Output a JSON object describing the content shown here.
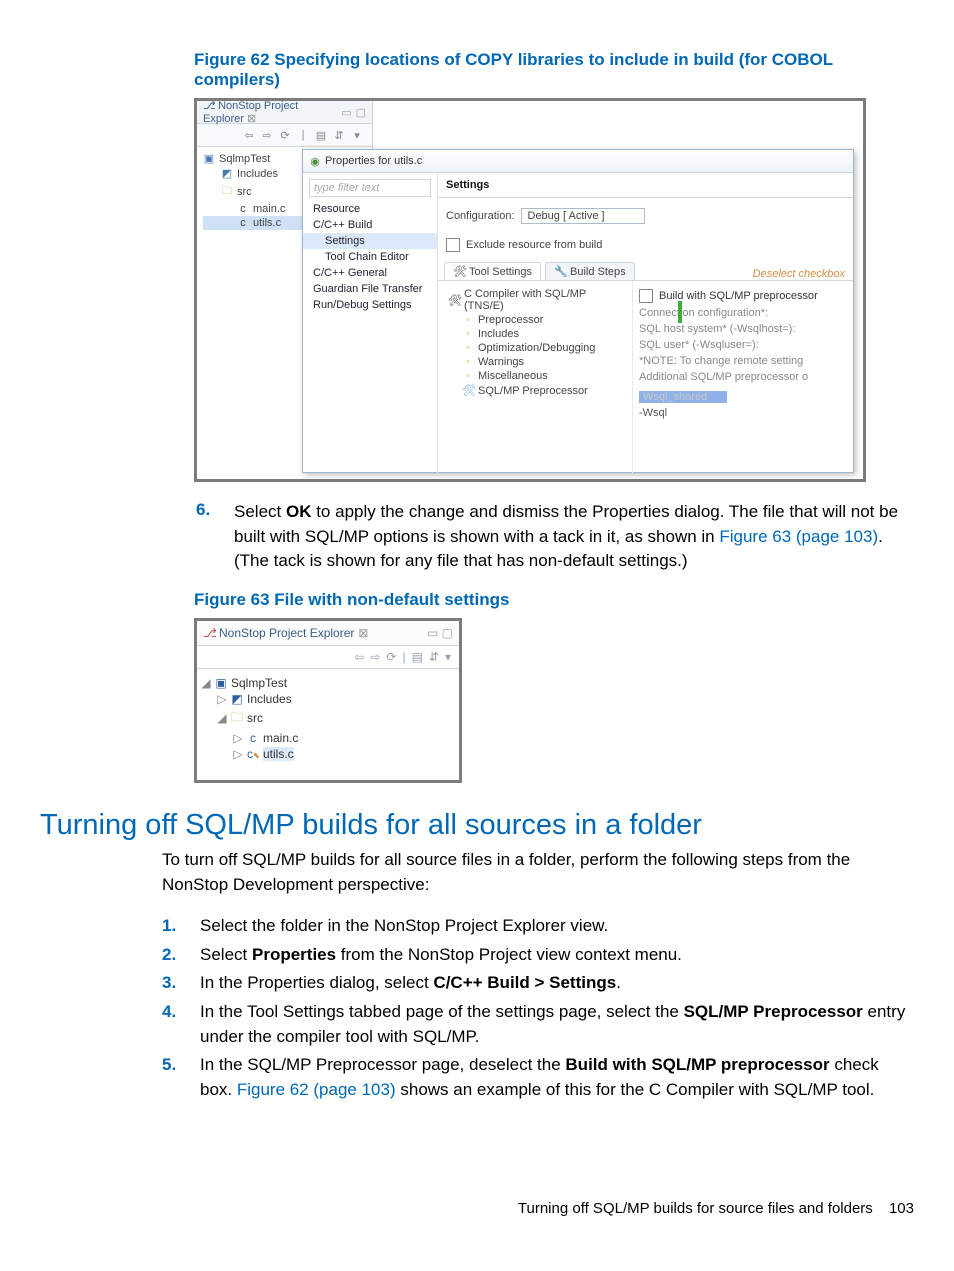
{
  "figure62": {
    "caption": "Figure 62 Specifying locations of COPY libraries to include in build (for COBOL compilers)",
    "explorer": {
      "title": "NonStop Project Explorer",
      "tree": {
        "project": "SqlmpTest",
        "includes": "Includes",
        "srcFolder": "src",
        "files": [
          "main.c",
          "utils.c"
        ]
      }
    },
    "properties": {
      "title": "Properties for utils.c",
      "filterPlaceholder": "type filter text",
      "nav": {
        "resource": "Resource",
        "build": "C/C++ Build",
        "settings": "Settings",
        "toolchain": "Tool Chain Editor",
        "general": "C/C++ General",
        "guardian": "Guardian File Transfer",
        "rundebug": "Run/Debug Settings"
      },
      "pageTitle": "Settings",
      "configLabel": "Configuration:",
      "configValue": "Debug  [ Active ]",
      "excludeLabel": "Exclude resource from build",
      "tabs": {
        "tool": "Tool Settings",
        "steps": "Build Steps"
      },
      "deselect": "Deselect checkbox",
      "toolTree": {
        "root": "C Compiler with SQL/MP (TNS/E)",
        "preproc": "Preprocessor",
        "includes": "Includes",
        "optdbg": "Optimization/Debugging",
        "warnings": "Warnings",
        "misc": "Miscellaneous",
        "sqlpre": "SQL/MP Preprocessor"
      },
      "form": {
        "buildWith": "Build with SQL/MP preprocessor",
        "connCfg": "Connection configuration*:",
        "sqlHost": "SQL host system* (-Wsqlhost=):",
        "sqlUser": "SQL user* (-Wsqluser=):",
        "note": "*NOTE: To change remote setting",
        "addl": "Additional SQL/MP preprocessor o",
        "wsqlBadge": "Wsql_shared",
        "wsql": "-Wsql"
      }
    }
  },
  "step6": {
    "num": "6.",
    "pre": "Select ",
    "ok": "OK",
    "mid1": " to apply the change and dismiss the Properties dialog. The file that will not be built with SQL/MP options is shown with a tack in it, as shown in ",
    "link": "Figure 63 (page 103)",
    "mid2": ". (The tack is shown for any file that has non-default settings.)"
  },
  "figure63": {
    "caption": "Figure 63 File with non-default settings",
    "title": "NonStop Project Explorer",
    "tree": {
      "project": "SqlmpTest",
      "includes": "Includes",
      "srcFolder": "src",
      "main": "main.c",
      "utils": "utils.c"
    }
  },
  "section": {
    "heading": "Turning off SQL/MP builds for all sources in a folder",
    "intro": "To turn off SQL/MP builds for all source files in a folder, perform the following steps from the NonStop Development perspective:",
    "steps": [
      {
        "num": "1.",
        "text": "Select the folder in the NonStop Project Explorer view."
      },
      {
        "num": "2.",
        "pre": "Select ",
        "b": "Properties",
        "post": " from the NonStop Project view context menu."
      },
      {
        "num": "3.",
        "pre": "In the Properties dialog, select ",
        "b": "C/C++ Build > Settings",
        "post": "."
      },
      {
        "num": "4.",
        "pre": "In the Tool Settings tabbed page of the settings page, select the ",
        "b": "SQL/MP Preprocessor",
        "post": "  entry under the compiler tool with SQL/MP."
      },
      {
        "num": "5.",
        "pre": "In the SQL/MP Preprocessor page, deselect the ",
        "b": "Build with SQL/MP preprocessor",
        "post": " check box. ",
        "link": "Figure 62 (page 103)",
        "post2": " shows an example of this for the C Compiler with SQL/MP tool."
      }
    ]
  },
  "footer": {
    "text": "Turning off SQL/MP builds for source files and folders",
    "page": "103"
  }
}
